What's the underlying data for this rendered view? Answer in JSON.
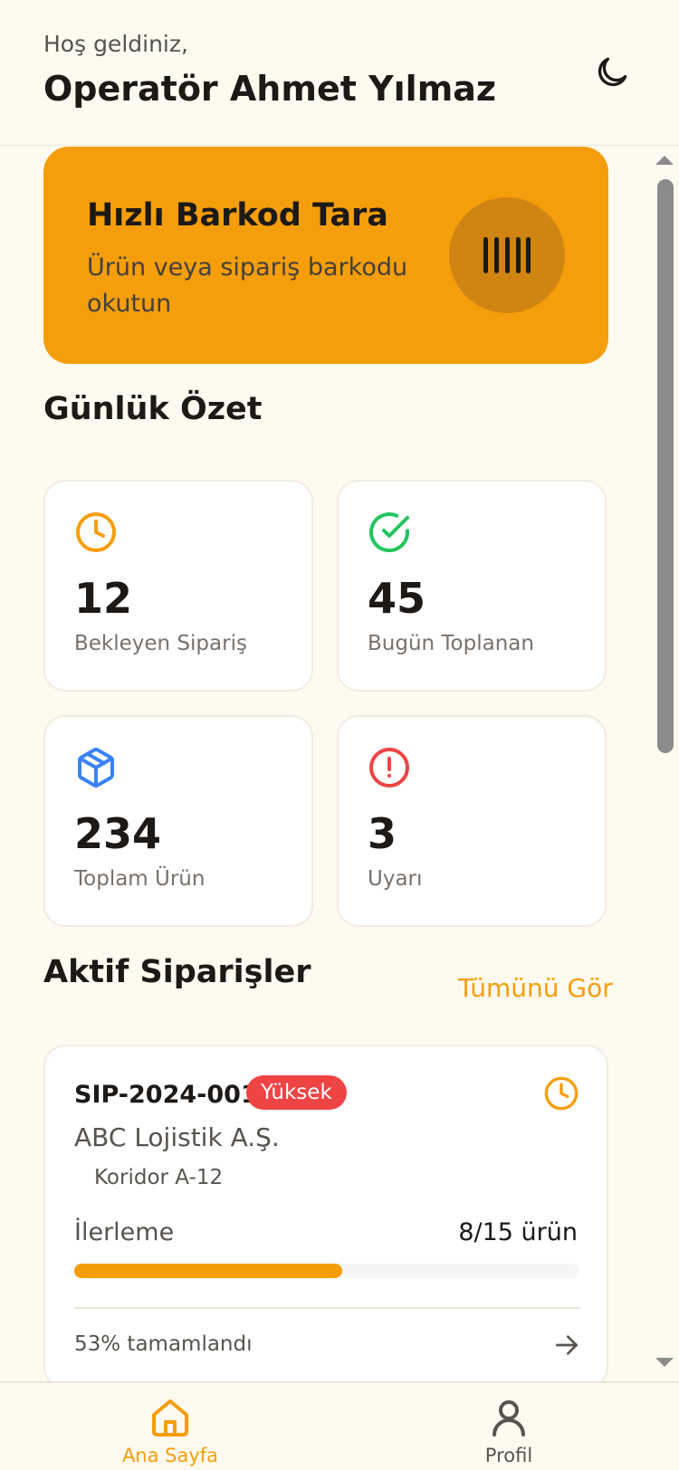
{
  "header": {
    "greeting": "Hoş geldiniz,",
    "user_name": "Operatör Ahmet Yılmaz"
  },
  "scan": {
    "title": "Hızlı Barkod Tara",
    "subtitle": "Ürün veya sipariş barkodu okutun"
  },
  "summary": {
    "title": "Günlük Özet",
    "stats": [
      {
        "value": "12",
        "label": "Bekleyen Sipariş",
        "icon": "clock-icon",
        "color": "#f59e0b"
      },
      {
        "value": "45",
        "label": "Bugün Toplanan",
        "icon": "check-circle-icon",
        "color": "#22c55e"
      },
      {
        "value": "234",
        "label": "Toplam Ürün",
        "icon": "package-icon",
        "color": "#3b82f6"
      },
      {
        "value": "3",
        "label": "Uyarı",
        "icon": "alert-circle-icon",
        "color": "#ef4444"
      }
    ]
  },
  "orders": {
    "title": "Aktif Siparişler",
    "see_all": "Tümünü Gör",
    "items": [
      {
        "id": "SIP-2024-001",
        "priority": "Yüksek",
        "company": "ABC Lojistik A.Ş.",
        "location": "Koridor A-12",
        "progress_label": "İlerleme",
        "progress_count": "8/15 ürün",
        "progress_fraction": 0.53,
        "completed_text": "53% tamamlandı"
      }
    ]
  },
  "nav": {
    "home": "Ana Sayfa",
    "profile": "Profil"
  },
  "colors": {
    "accent": "#f59e0b",
    "background": "#fffaf0",
    "danger": "#ef4444"
  }
}
